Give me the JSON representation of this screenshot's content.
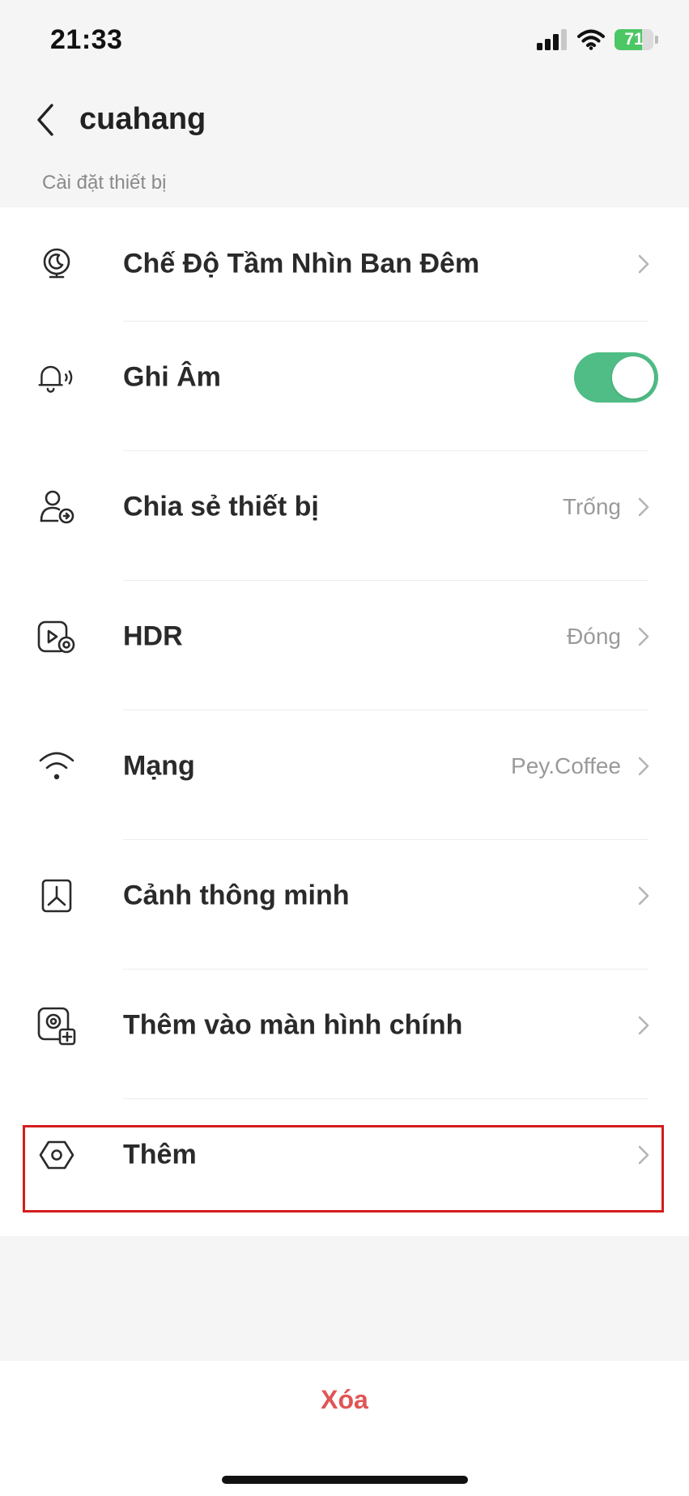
{
  "status_bar": {
    "time": "21:33",
    "battery_text": "71",
    "battery_level": 0.71,
    "battery_color": "#4cc764"
  },
  "header": {
    "title": "cuahang",
    "back_icon": "chevron-left-icon"
  },
  "section": {
    "label": "Cài đặt thiết bị"
  },
  "settings": {
    "items": [
      {
        "label": "Chế Độ Tầm Nhìn Ban Đêm",
        "value": "",
        "icon": "night-vision-icon",
        "control": "chevron"
      },
      {
        "label": "Ghi Âm",
        "value": "",
        "icon": "audio-recording-icon",
        "control": "toggle",
        "toggle_on": true
      },
      {
        "label": "Chia sẻ thiết bị",
        "value": "Trống",
        "icon": "share-device-icon",
        "control": "chevron"
      },
      {
        "label": "HDR",
        "value": "Đóng",
        "icon": "hdr-icon",
        "control": "chevron"
      },
      {
        "label": "Mạng",
        "value": "Pey.Coffee",
        "icon": "wifi-icon",
        "control": "chevron"
      },
      {
        "label": "Cảnh thông minh",
        "value": "",
        "icon": "smart-scene-icon",
        "control": "chevron"
      },
      {
        "label": "Thêm vào màn hình chính",
        "value": "",
        "icon": "add-to-home-icon",
        "control": "chevron"
      },
      {
        "label": "Thêm",
        "value": "",
        "icon": "more-settings-icon",
        "control": "chevron",
        "highlighted": true
      }
    ]
  },
  "footer": {
    "delete_label": "Xóa",
    "delete_color": "#e05555"
  },
  "colors": {
    "toggle_on": "#4fbd85",
    "highlight_border": "#d41c1c"
  }
}
